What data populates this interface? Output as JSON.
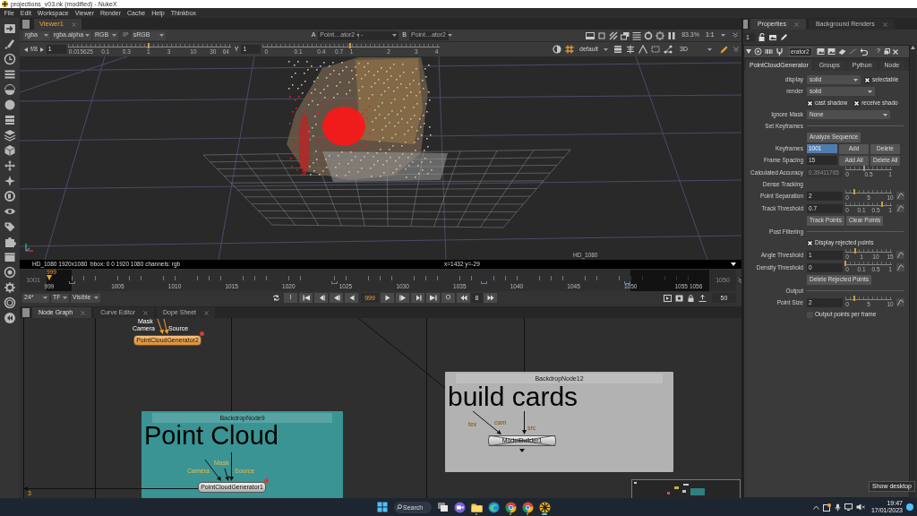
{
  "window": {
    "title": "projections_v03.nk (modified) - NukeX"
  },
  "menu": [
    "File",
    "Edit",
    "Workspace",
    "Viewer",
    "Render",
    "Cache",
    "Help",
    "Thinkbox"
  ],
  "viewer": {
    "tab": "Viewer1",
    "channels": "rgba",
    "alpha_channel": "rgba.alpha",
    "display": "RGB",
    "ip": "IP",
    "lut": "sRGB",
    "input_a": {
      "label": "A",
      "node": "Point…ator2"
    },
    "compare": "-",
    "input_b": {
      "label": "B",
      "node": "Point…ator2"
    },
    "zoom": "83.3%",
    "ratio": "1:1",
    "gain": {
      "fstop": "f/8",
      "value": "1",
      "level": 0.495,
      "ticks": [
        "0.015625",
        "0.1",
        "0.3",
        "1",
        "3",
        "10",
        "30",
        "64"
      ]
    },
    "gamma": {
      "label": "Y",
      "value": "1",
      "level": 0.495,
      "ticks": [
        "0",
        "0.1",
        "0.4",
        "0.7",
        "1",
        "2",
        "3",
        "4"
      ]
    },
    "camera": "default",
    "view_mode": "3D",
    "format": "HD_1080",
    "info": "HD_1080 1920x1080  bbox: 0 0 1920 1080 channels: rgb",
    "cursor": "x=1432 y=-29"
  },
  "timeline": {
    "in": "1001",
    "out": "1050",
    "playhead": "999",
    "level": 0,
    "labels": [
      "999",
      "1005",
      "1010",
      "1015",
      "1020",
      "1025",
      "1030",
      "1035",
      "1040",
      "1045",
      "1050",
      "1055",
      "1056"
    ]
  },
  "playback": {
    "fps": "24*",
    "time_format": "TF",
    "visibility": "Visible",
    "in_point": "I",
    "frame": "999",
    "out_point": "O",
    "increment": "8",
    "end": "50"
  },
  "node_graph": {
    "tabs": [
      {
        "label": "Node Graph",
        "selected": true
      },
      {
        "label": "Curve Editor",
        "selected": false
      },
      {
        "label": "Dope Sheet",
        "selected": false
      }
    ],
    "backdrops": [
      {
        "title": "BackdropNode9",
        "label": "Point Cloud",
        "color": "#3a9494"
      },
      {
        "title": "BackdropNode12",
        "label": "build cards",
        "color": "#b2b2b2"
      }
    ],
    "nodes": [
      {
        "name": "PointCloudGenerator2",
        "selected": true,
        "disabled": false,
        "inputs": [
          "Mask",
          "Camera",
          "Source"
        ]
      },
      {
        "name": "PointCloudGenerator1",
        "selected": false,
        "disabled": false,
        "inputs": [
          "Mask",
          "Camera",
          "Source"
        ]
      },
      {
        "name": "ModelBuilder1",
        "selected": false,
        "disabled": true,
        "inputs": [
          "tex",
          "cam",
          "src"
        ]
      }
    ],
    "edge_label": "3"
  },
  "properties": {
    "tabs": [
      {
        "label": "Properties",
        "selected": true
      },
      {
        "label": "Background Renders",
        "selected": false
      }
    ],
    "max_panels": "1",
    "node_name": "erator2",
    "help": "?",
    "node_tabs": [
      {
        "label": "PointCloudGenerator",
        "selected": true
      },
      {
        "label": "Groups",
        "selected": false
      },
      {
        "label": "Python",
        "selected": false
      },
      {
        "label": "Node",
        "selected": false
      }
    ],
    "rows": [
      {
        "kind": "dropdown",
        "label": "display",
        "value": "solid",
        "checkbox": {
          "label": "selectable",
          "checked": true
        }
      },
      {
        "kind": "dropdown",
        "label": "render",
        "value": "solid"
      },
      {
        "kind": "checkboxes",
        "items": [
          {
            "label": "cast shadow",
            "checked": true
          },
          {
            "label": "receive shado",
            "checked": true
          }
        ]
      },
      {
        "kind": "dropdown",
        "label": "Ignore Mask",
        "value": "None"
      },
      {
        "kind": "section",
        "label": "Set Keyframes",
        "divider": true
      },
      {
        "kind": "buttons",
        "buttons": [
          "Analyze Sequence"
        ]
      },
      {
        "kind": "field_buttons",
        "label": "Keyframes",
        "value": "1001",
        "highlighted": true,
        "buttons": [
          "Add",
          "Delete"
        ]
      },
      {
        "kind": "field_buttons",
        "label": "Frame Spacing",
        "value": "15",
        "highlighted": false,
        "buttons": [
          "Add All",
          "Delete All"
        ]
      },
      {
        "kind": "slider",
        "label": "Calculated Accuracy",
        "value": "0.39411765",
        "disabled": true,
        "animatable": false,
        "level": 0.4,
        "ticks": [
          "0",
          "0.5",
          "1"
        ]
      },
      {
        "kind": "section",
        "label": "Dense Tracking",
        "divider": false
      },
      {
        "kind": "slider",
        "label": "Point Separation",
        "value": "2",
        "disabled": false,
        "animatable": true,
        "level": 0.2,
        "ticks": [
          "0",
          "5",
          "10"
        ]
      },
      {
        "kind": "slider",
        "label": "Track Threshold",
        "value": "0.7",
        "disabled": false,
        "animatable": true,
        "level": 0.78,
        "ticks": [
          "0",
          "0.1",
          "0.5",
          "1"
        ]
      },
      {
        "kind": "buttons",
        "buttons": [
          "Track Points",
          "Clear Points"
        ]
      },
      {
        "kind": "section",
        "label": "Post Filtering",
        "divider": true
      },
      {
        "kind": "checkbox",
        "label": "Display rejected points",
        "checked": true
      },
      {
        "kind": "slider",
        "label": "Angle Threshold",
        "value": "1",
        "disabled": false,
        "animatable": true,
        "level": 0.22,
        "ticks": [
          "0",
          "1",
          "10",
          "15"
        ]
      },
      {
        "kind": "slider",
        "label": "Density Threshold",
        "value": "0",
        "disabled": false,
        "animatable": true,
        "level": 0,
        "ticks": [
          "0",
          "0.1",
          "0.5",
          "1"
        ]
      },
      {
        "kind": "buttons",
        "buttons": [
          "Delete Rejected Points"
        ]
      },
      {
        "kind": "section",
        "label": "Output",
        "divider": true
      },
      {
        "kind": "slider",
        "label": "Point Size",
        "value": "2",
        "disabled": false,
        "animatable": true,
        "level": 0.2,
        "ticks": [
          "0",
          "5",
          "10"
        ]
      },
      {
        "kind": "checkbox",
        "label": "Output points per frame",
        "checked": false
      }
    ]
  },
  "taskbar": {
    "search_placeholder": "Search",
    "apps": [
      {
        "kind": "task_view",
        "open": false,
        "active": false
      },
      {
        "kind": "chat",
        "open": false,
        "active": false
      },
      {
        "kind": "folder",
        "open": true,
        "active": false
      },
      {
        "kind": "edge",
        "open": false,
        "active": false
      },
      {
        "kind": "chrome",
        "open": true,
        "active": false
      },
      {
        "kind": "chrome",
        "open": true,
        "active": false
      },
      {
        "kind": "nuke",
        "open": true,
        "active": true
      }
    ],
    "time": "19:47",
    "date": "17/01/2023",
    "tooltip": "Show desktop"
  }
}
